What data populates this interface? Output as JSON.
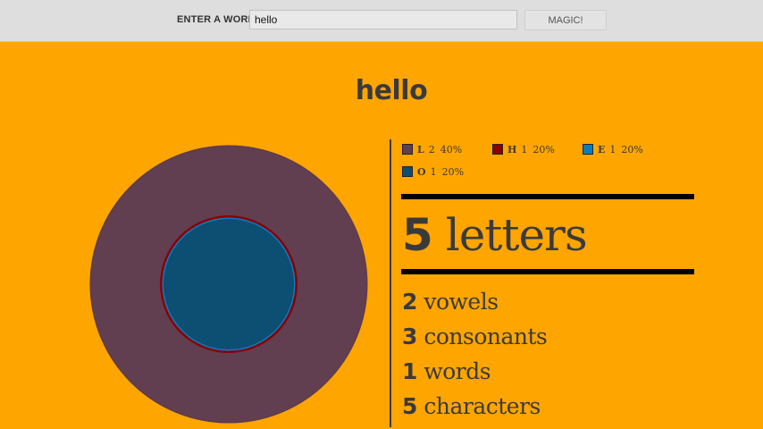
{
  "form": {
    "label": "ENTER A WORD",
    "input_value": "hello",
    "button_label": "MAGIC!"
  },
  "word": "hello",
  "colors": {
    "background": "#FFA500",
    "letter_L": "#613E50",
    "letter_H": "#8B0000",
    "letter_E": "#0A7BC0",
    "letter_O": "#0D4E73"
  },
  "legend": [
    {
      "letter": "L",
      "count": "2",
      "percent": "40%",
      "color": "#613E50"
    },
    {
      "letter": "H",
      "count": "1",
      "percent": "20%",
      "color": "#8B0000"
    },
    {
      "letter": "E",
      "count": "1",
      "percent": "20%",
      "color": "#0A7BC0"
    },
    {
      "letter": "O",
      "count": "1",
      "percent": "20%",
      "color": "#0D4E73"
    }
  ],
  "stats": {
    "letters": {
      "value": "5",
      "label": "letters"
    },
    "vowels": {
      "value": "2",
      "label": "vowels"
    },
    "consonants": {
      "value": "3",
      "label": "consonants"
    },
    "words": {
      "value": "1",
      "label": "words"
    },
    "characters": {
      "value": "5",
      "label": "characters"
    }
  },
  "chart_data": {
    "type": "pie",
    "categories": [
      "L",
      "H",
      "E",
      "O"
    ],
    "values": [
      2,
      1,
      1,
      1
    ],
    "percents": [
      40,
      20,
      20,
      20
    ],
    "title": ""
  }
}
